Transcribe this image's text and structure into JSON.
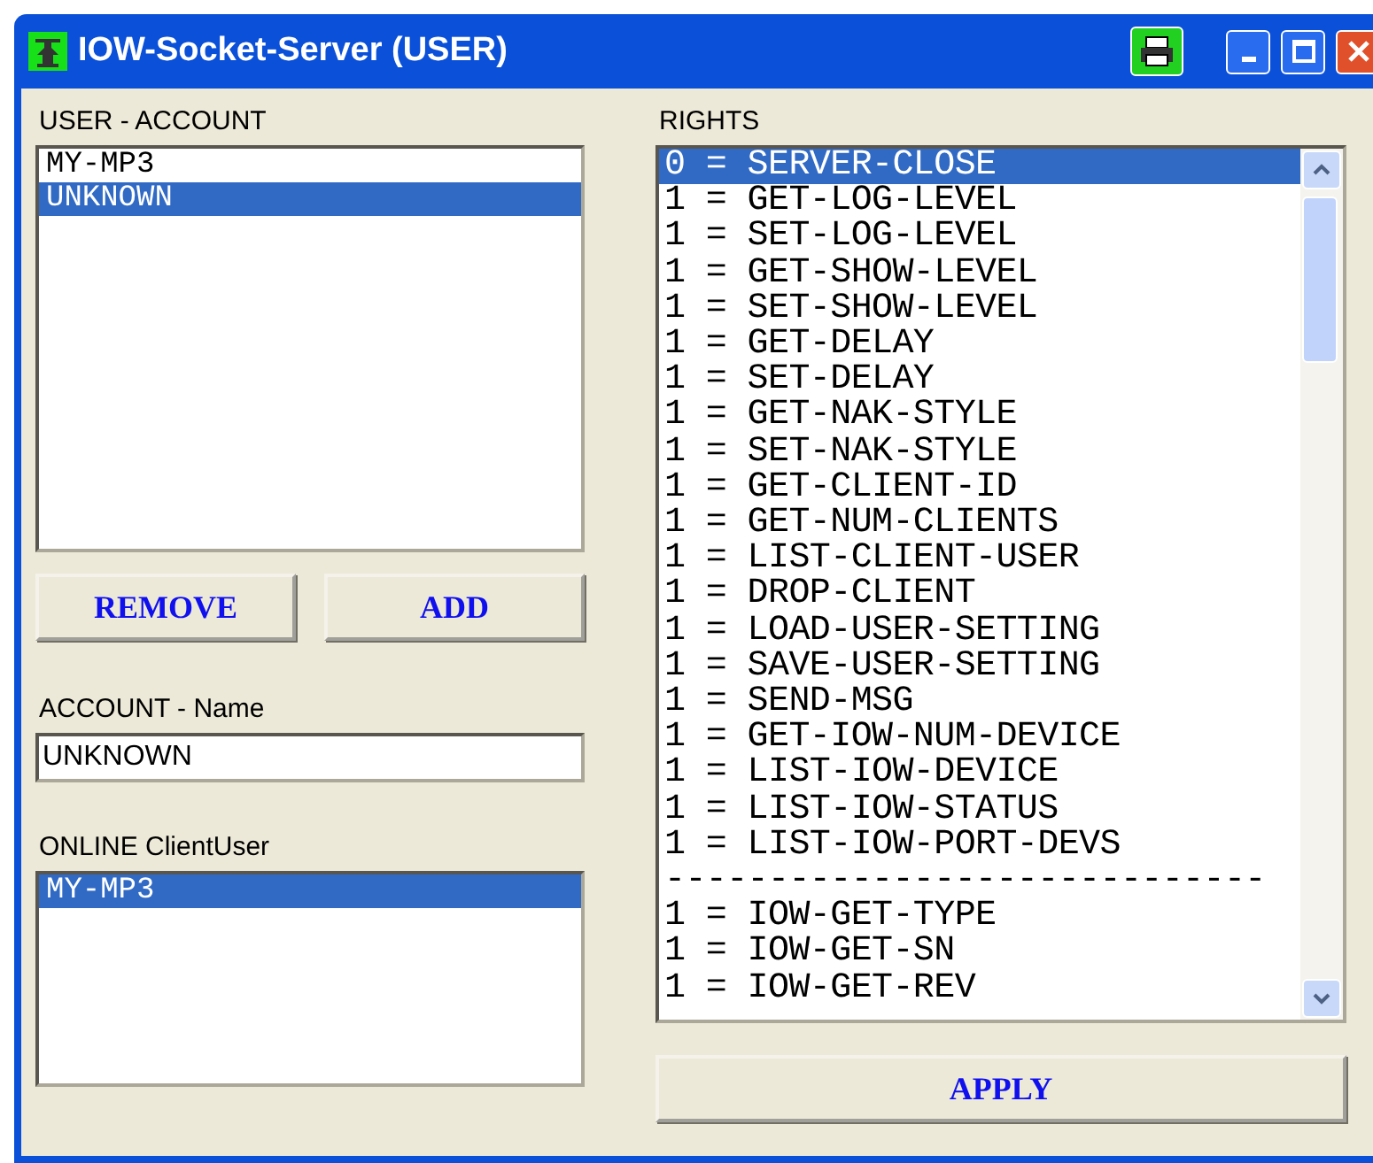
{
  "window": {
    "title": "IOW-Socket-Server (USER)"
  },
  "user_account": {
    "label": "USER - ACCOUNT",
    "items": [
      {
        "text": "MY-MP3",
        "selected": false
      },
      {
        "text": "UNKNOWN",
        "selected": true
      }
    ]
  },
  "buttons": [
    {
      "label": "REMOVE"
    },
    {
      "label": "ADD"
    }
  ],
  "account_name": {
    "label": "ACCOUNT - Name",
    "value": "UNKNOWN"
  },
  "online": {
    "label": "ONLINE ClientUser",
    "items": [
      {
        "text": "MY-MP3",
        "selected": true
      }
    ]
  },
  "rights": {
    "label": "RIGHTS",
    "items": [
      {
        "kind": "right",
        "text": "0 = SERVER-CLOSE",
        "selected": true
      },
      {
        "kind": "right",
        "text": "1 = GET-LOG-LEVEL",
        "selected": false
      },
      {
        "kind": "right",
        "text": "1 = SET-LOG-LEVEL",
        "selected": false
      },
      {
        "kind": "right",
        "text": "1 = GET-SHOW-LEVEL",
        "selected": false
      },
      {
        "kind": "right",
        "text": "1 = SET-SHOW-LEVEL",
        "selected": false
      },
      {
        "kind": "right",
        "text": "1 = GET-DELAY",
        "selected": false
      },
      {
        "kind": "right",
        "text": "1 = SET-DELAY",
        "selected": false
      },
      {
        "kind": "right",
        "text": "1 = GET-NAK-STYLE",
        "selected": false
      },
      {
        "kind": "right",
        "text": "1 = SET-NAK-STYLE",
        "selected": false
      },
      {
        "kind": "right",
        "text": "1 = GET-CLIENT-ID",
        "selected": false
      },
      {
        "kind": "right",
        "text": "1 = GET-NUM-CLIENTS",
        "selected": false
      },
      {
        "kind": "right",
        "text": "1 = LIST-CLIENT-USER",
        "selected": false
      },
      {
        "kind": "right",
        "text": "1 = DROP-CLIENT",
        "selected": false
      },
      {
        "kind": "right",
        "text": "1 = LOAD-USER-SETTING",
        "selected": false
      },
      {
        "kind": "right",
        "text": "1 = SAVE-USER-SETTING",
        "selected": false
      },
      {
        "kind": "right",
        "text": "1 = SEND-MSG",
        "selected": false
      },
      {
        "kind": "right",
        "text": "1 = GET-IOW-NUM-DEVICE",
        "selected": false
      },
      {
        "kind": "right",
        "text": "1 = LIST-IOW-DEVICE",
        "selected": false
      },
      {
        "kind": "right",
        "text": "1 = LIST-IOW-STATUS",
        "selected": false
      },
      {
        "kind": "right",
        "text": "1 = LIST-IOW-PORT-DEVS",
        "selected": false
      },
      {
        "kind": "separator",
        "text": "-----------------------------"
      },
      {
        "kind": "right",
        "text": "1 = IOW-GET-TYPE",
        "selected": false
      },
      {
        "kind": "right",
        "text": "1 = IOW-GET-SN",
        "selected": false
      },
      {
        "kind": "right",
        "text": "1 = IOW-GET-REV",
        "selected": false
      }
    ]
  },
  "apply_button": {
    "label": "APPLY"
  }
}
